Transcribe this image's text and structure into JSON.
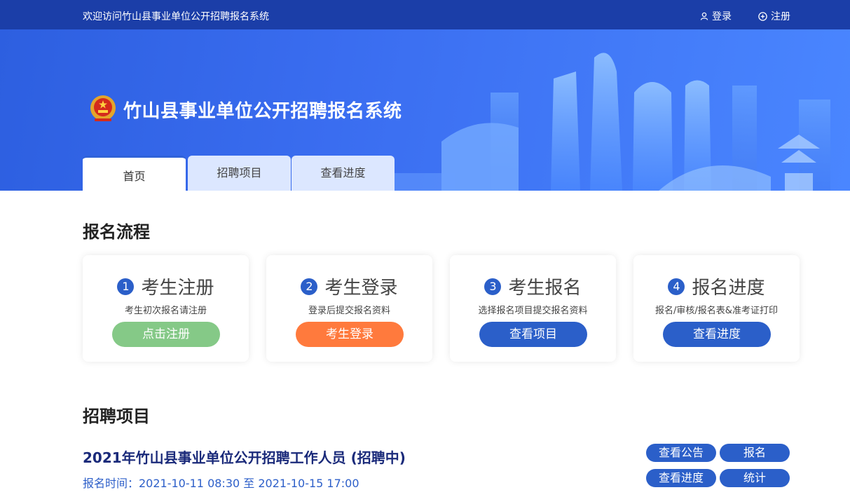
{
  "topbar": {
    "welcome": "欢迎访问竹山县事业单位公开招聘报名系统",
    "login": "登录",
    "register": "注册"
  },
  "header": {
    "title": "竹山县事业单位公开招聘报名系统"
  },
  "tabs": [
    {
      "label": "首页"
    },
    {
      "label": "招聘项目"
    },
    {
      "label": "查看进度"
    }
  ],
  "process": {
    "title": "报名流程",
    "steps": [
      {
        "num": "1",
        "title": "考生注册",
        "desc": "考生初次报名请注册",
        "button": "点击注册",
        "color": "#85c987"
      },
      {
        "num": "2",
        "title": "考生登录",
        "desc": "登录后提交报名资料",
        "button": "考生登录",
        "color": "#ff7a3d"
      },
      {
        "num": "3",
        "title": "考生报名",
        "desc": "选择报名项目提交报名资料",
        "button": "查看项目",
        "color": "#2b5fc9"
      },
      {
        "num": "4",
        "title": "报名进度",
        "desc": "报名/审核/报名表&准考证打印",
        "button": "查看进度",
        "color": "#2b5fc9"
      }
    ]
  },
  "projects": {
    "title": "招聘项目",
    "items": [
      {
        "title": "2021年竹山县事业单位公开招聘工作人员 (招聘中)",
        "time": "报名时间：2021-10-11 08:30 至 2021-10-15 17:00",
        "buttons": {
          "notice": "查看公告",
          "apply": "报名",
          "progress": "查看进度",
          "stats": "统计"
        }
      }
    ]
  },
  "colors": {
    "topbar": "#1b3ea8",
    "banner": "#3a6df0",
    "primary": "#2b5fc9"
  }
}
